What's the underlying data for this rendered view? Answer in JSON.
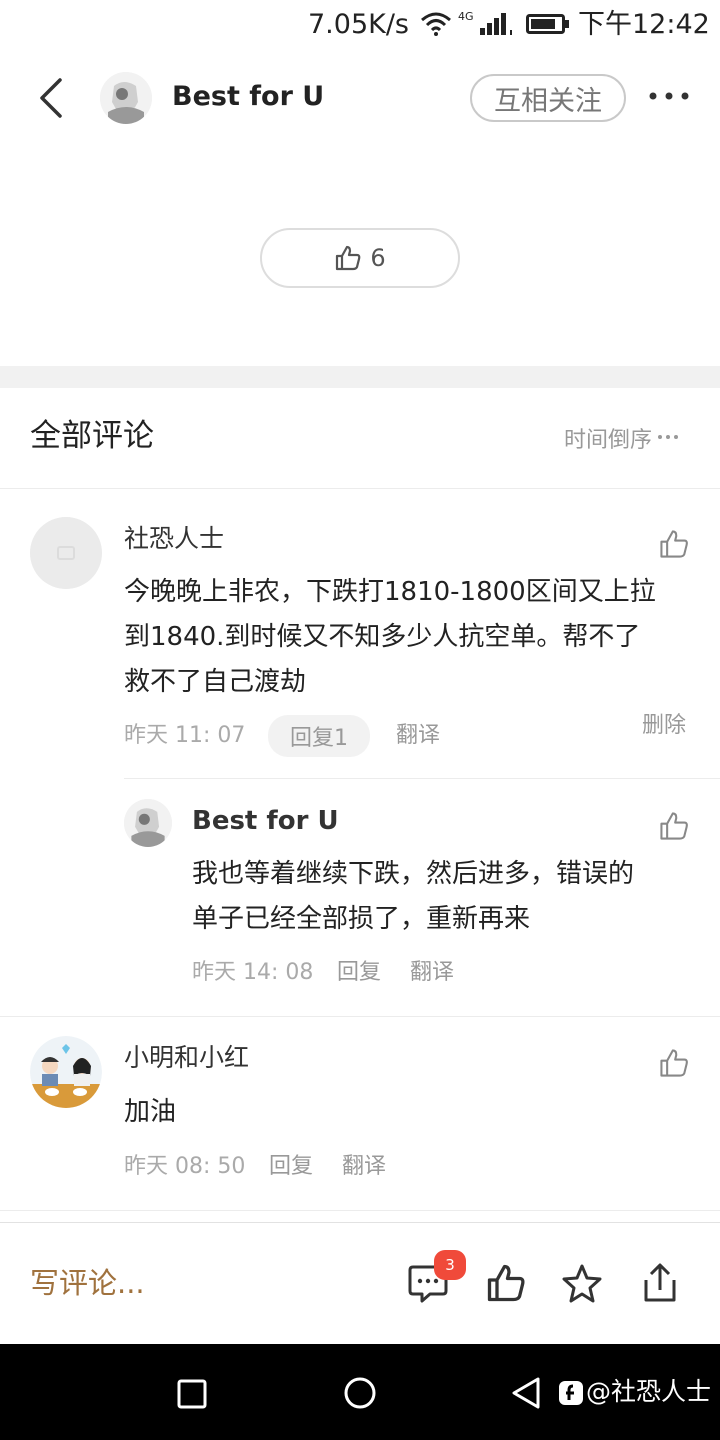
{
  "status_bar": {
    "speed": "7.05K/s",
    "network": "4G",
    "time": "下午12:42"
  },
  "header": {
    "title": "Best for U",
    "follow_label": "互相关注",
    "back_icon": "chevron-left-icon",
    "more_icon": "more-dots-icon"
  },
  "post_like": {
    "count": "6",
    "icon": "thumbs-up-icon"
  },
  "comments_section": {
    "title": "全部评论",
    "sort_label": "时间倒序",
    "comments": [
      {
        "user": "社恐人士",
        "text_lines": [
          "今晚晚上非农，下跌打1810-1800区间又上拉",
          "到1840.到时候又不知多少人抗空单。帮不了",
          "救不了自己渡劫"
        ],
        "time": "昨天 11: 07",
        "reply_label": "回复1",
        "translate_label": "翻译",
        "delete_label": "删除",
        "reply": {
          "user": "Best for U",
          "text_lines": [
            "我也等着继续下跌，然后进多，错误的",
            "单子已经全部损了，重新再来"
          ],
          "time": "昨天 14: 08",
          "reply_label": "回复",
          "translate_label": "翻译"
        }
      },
      {
        "user": "小明和小红",
        "text_lines": [
          "加油"
        ],
        "time": "昨天 08: 50",
        "reply_label": "回复",
        "translate_label": "翻译"
      }
    ]
  },
  "bottom_bar": {
    "write_placeholder": "写评论...",
    "comment_count_badge": "3"
  },
  "nav_bar": {
    "watermark": "@社恐人士"
  },
  "colors": {
    "accent_write": "#a0723e",
    "badge": "#f04a3a",
    "nav_background": "#000000"
  }
}
